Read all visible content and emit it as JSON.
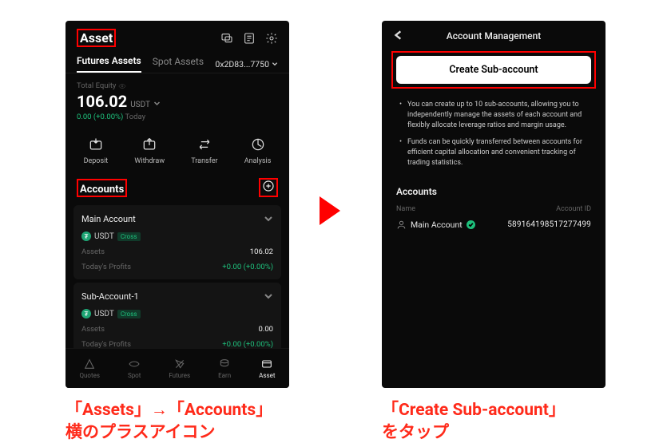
{
  "left": {
    "title": "Asset",
    "tabs": {
      "futures": "Futures Assets",
      "spot": "Spot Assets"
    },
    "wallet": "0x2D83...7750",
    "equity": {
      "label": "Total Equity",
      "value": "106.02",
      "unit": "USDT",
      "change": "0.00 (+0.00%)",
      "period": "Today"
    },
    "actions": {
      "deposit": "Deposit",
      "withdraw": "Withdraw",
      "transfer": "Transfer",
      "analysis": "Analysis"
    },
    "accountsTitle": "Accounts",
    "accounts": [
      {
        "name": "Main Account",
        "coin": "USDT",
        "mode": "Cross",
        "assetsLabel": "Assets",
        "assetsValue": "106.02",
        "profitsLabel": "Today's Profits",
        "profitsValue": "+0.00 (+0.00%)"
      },
      {
        "name": "Sub-Account-1",
        "coin": "USDT",
        "mode": "Cross",
        "assetsLabel": "Assets",
        "assetsValue": "0.00",
        "profitsLabel": "Today's Profits",
        "profitsValue": "+0.00 (+0.00%)"
      }
    ],
    "tabbar": {
      "quotes": "Quotes",
      "spot": "Spot",
      "futures": "Futures",
      "earn": "Earn",
      "asset": "Asset"
    }
  },
  "right": {
    "title": "Account Management",
    "createBtn": "Create Sub-account",
    "bullets": [
      "You can create up to 10 sub-accounts, allowing you to independently manage the assets of each account and flexibly allocate leverage ratios and margin usage.",
      "Funds can be quickly transferred between accounts for efficient capital allocation and convenient tracking of trading statistics."
    ],
    "sectionTitle": "Accounts",
    "cols": {
      "name": "Name",
      "id": "Account ID"
    },
    "item": {
      "name": "Main Account",
      "id": "589164198517277499"
    }
  },
  "captions": {
    "left": "「Assets」→「Accounts」\n横のプラスアイコン",
    "right": "「Create Sub-account」\nをタップ"
  }
}
